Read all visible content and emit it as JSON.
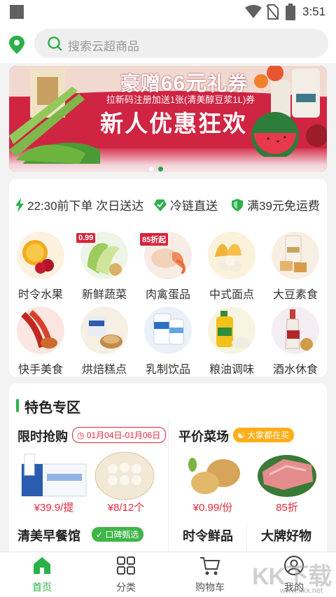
{
  "status_bar": {
    "time": "3:51"
  },
  "search": {
    "placeholder": "搜索云超商品"
  },
  "banner": {
    "gift_prefix": "豪赠",
    "gift_amount": "66元",
    "gift_suffix": "礼券",
    "subtitle": "拉新码注册加送1张(清美醇豆浆1L)券",
    "headline": "新人优惠狂欢",
    "slide_count": 2,
    "active_slide": 2
  },
  "features": [
    {
      "icon": "lightning-icon",
      "label": "22:30前下单 次日送达"
    },
    {
      "icon": "check-heart-icon",
      "label": "冷链直送"
    },
    {
      "icon": "shield-icon",
      "label": "满39元免运费"
    }
  ],
  "categories": [
    {
      "label": "时令水果",
      "tag": ""
    },
    {
      "label": "新鲜蔬菜",
      "tag": "0.99"
    },
    {
      "label": "肉禽蛋品",
      "tag": "85折起"
    },
    {
      "label": "中式面点",
      "tag": ""
    },
    {
      "label": "大豆素食",
      "tag": ""
    },
    {
      "label": "快手美食",
      "tag": ""
    },
    {
      "label": "烘焙糕点",
      "tag": ""
    },
    {
      "label": "乳制饮品",
      "tag": ""
    },
    {
      "label": "粮油调味",
      "tag": ""
    },
    {
      "label": "酒水休食",
      "tag": ""
    }
  ],
  "featured": {
    "title": "特色专区",
    "flash_sale": {
      "title": "限时抢购",
      "date_range": "01月04日-01月06日",
      "items": [
        {
          "price": "¥39.9/提"
        },
        {
          "price": "¥8/12个"
        }
      ]
    },
    "cheap_veg": {
      "title": "平价菜场",
      "badge": "大家都在买",
      "items": [
        {
          "price": "¥0.99/份"
        },
        {
          "price": "85折"
        }
      ]
    },
    "breakfast": {
      "title": "清美早餐馆",
      "badge": "口碑甄选"
    },
    "seasonal": {
      "title": "时令鲜品"
    },
    "brands": {
      "title": "大牌好物"
    }
  },
  "tabbar": [
    {
      "label": "首页",
      "icon": "home-icon",
      "active": true
    },
    {
      "label": "分类",
      "icon": "grid-icon",
      "active": false
    },
    {
      "label": "购物车",
      "icon": "cart-icon",
      "active": false
    },
    {
      "label": "我的",
      "icon": "user-icon",
      "active": false
    }
  ],
  "colors": {
    "brand_green": "#2cb14a",
    "banner_red": "#cf2442",
    "price_red": "#e5283c",
    "badge_orange": "#ffae1a"
  },
  "watermark": {
    "text": "KK下载",
    "url": "www.kkx.net"
  }
}
